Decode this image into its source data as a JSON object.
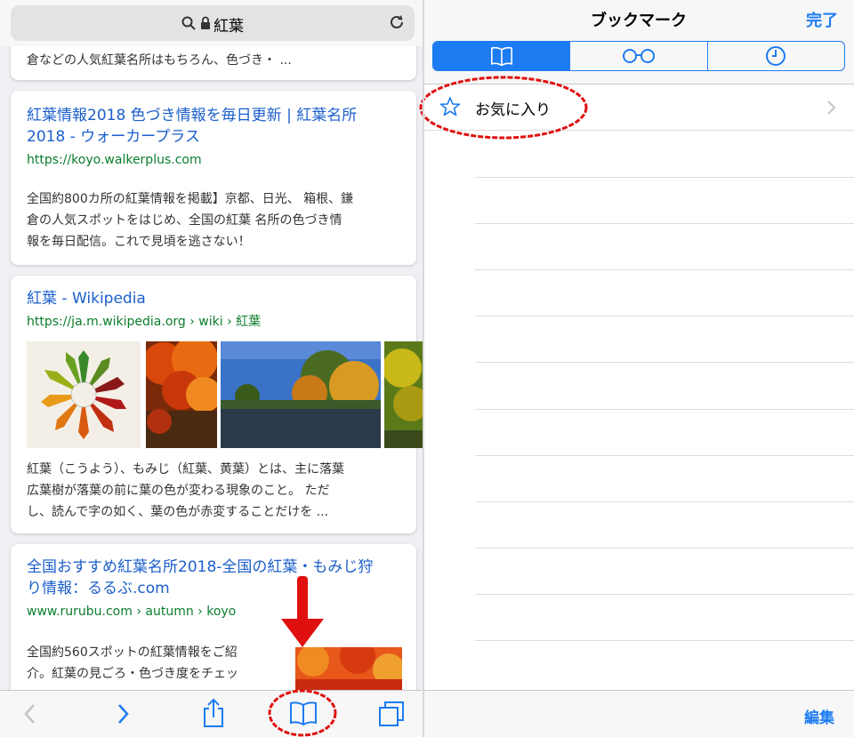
{
  "left": {
    "address": "紅葉",
    "results": [
      {
        "snippet": "倉などの人気紅葉名所はもちろん、色づき・ ..."
      },
      {
        "title_line1": "紅葉情報2018 色づき情報を毎日更新 | 紅葉名所",
        "title_line2": "2018 - ウォーカープラス",
        "url": "https://koyo.walkerplus.com",
        "snippet_line1": "全国約800カ所の紅葉情報を掲載】京都、日光、 箱根、鎌",
        "snippet_line2": "倉の人気スポットをはじめ、全国の紅葉 名所の色づき情",
        "snippet_line3": "報を毎日配信。これで見頃を逃さない！"
      },
      {
        "title": "紅葉 - Wikipedia",
        "url": "https://ja.m.wikipedia.org › wiki › 紅葉",
        "snippet_line1": "紅葉（こうよう）、もみじ（紅葉、黄葉）とは、主に落葉",
        "snippet_line2": "広葉樹が落葉の前に葉の色が変わる現象のこと。 ただ",
        "snippet_line3": "し、読んで字の如く、葉の色が赤変することだけを ..."
      },
      {
        "title_line1": "全国おすすめ紅葉名所2018-全国の紅葉・もみじ狩",
        "title_line2": "り情報：るるぶ.com",
        "url": "www.rurubu.com › autumn › koyo",
        "snippet_line1": "全国約560スポットの紅葉情報をご紹",
        "snippet_line2": "介。紅葉の見ごろ・色づき度をチェッ"
      }
    ],
    "toolbar_icons": [
      "back-icon",
      "forward-icon",
      "share-icon",
      "bookmarks-icon",
      "tabs-icon"
    ]
  },
  "right": {
    "title": "ブックマーク",
    "done_label": "完了",
    "segments": [
      "bookmarks-icon",
      "reading-list-icon",
      "history-icon"
    ],
    "favorites_label": "お気に入り",
    "edit_label": "編集"
  },
  "colors": {
    "accent": "#1d7cf2",
    "link": "#1b5fcc",
    "url": "#0a7d2c",
    "annotation": "#e01010"
  }
}
